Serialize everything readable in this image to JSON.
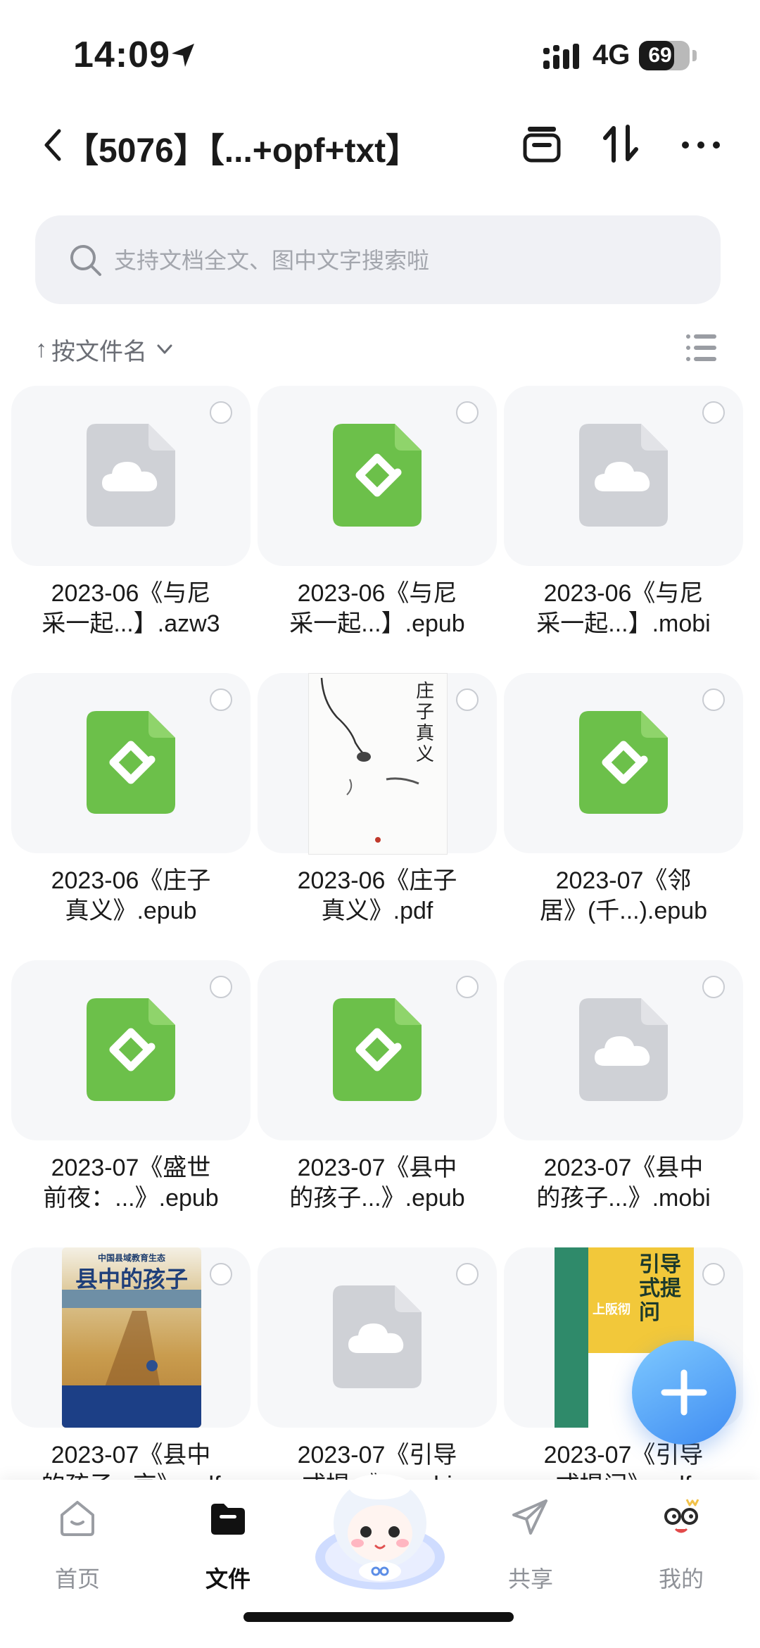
{
  "status_bar": {
    "time": "14:09",
    "network": "4G",
    "battery": "69",
    "battery_level": 0.69
  },
  "header": {
    "title": "【5076】【...+opf+txt】",
    "icons": [
      "back-icon",
      "archive-icon",
      "sort-toggle-icon",
      "more-icon"
    ]
  },
  "search": {
    "placeholder": "支持文档全文、图中文字搜索啦"
  },
  "sort": {
    "label": "按文件名",
    "arrow": "↑"
  },
  "files": [
    {
      "line1": "2023-06《与尼",
      "line2": "采一起...】.azw3",
      "icon": "cloud-file-icon"
    },
    {
      "line1": "2023-06《与尼",
      "line2": "采一起...】.epub",
      "icon": "epub-icon"
    },
    {
      "line1": "2023-06《与尼",
      "line2": "采一起...】.mobi",
      "icon": "cloud-file-icon"
    },
    {
      "line1": "2023-06《庄子",
      "line2": "真义》.epub",
      "icon": "epub-icon"
    },
    {
      "line1": "2023-06《庄子",
      "line2": "真义》.pdf",
      "icon": "book-cover-thumbnail",
      "cover_title": "庄子真义"
    },
    {
      "line1": "2023-07《邻",
      "line2": "居》(千...).epub",
      "icon": "epub-icon"
    },
    {
      "line1": "2023-07《盛世",
      "line2": "前夜：...》.epub",
      "icon": "epub-icon"
    },
    {
      "line1": "2023-07《县中",
      "line2": "的孩子...》.epub",
      "icon": "epub-icon"
    },
    {
      "line1": "2023-07《县中",
      "line2": "的孩子...》.mobi",
      "icon": "cloud-file-icon"
    },
    {
      "line1": "2023-07《县中",
      "line2": "的孩子...京》.pdf",
      "icon": "book-cover-thumbnail",
      "cover_title": "县中的孩子",
      "cover_subtitle": "中国县域教育生态"
    },
    {
      "line1": "2023-07《引导",
      "line2": "式提...》.mobi",
      "icon": "cloud-file-icon"
    },
    {
      "line1": "2023-07《引导",
      "line2": "式提问》.pdf",
      "icon": "book-cover-thumbnail",
      "cover_title": "引导式提问",
      "cover_subtitle": "上阪彻"
    }
  ],
  "tabs": [
    {
      "label": "首页",
      "icon": "home-icon"
    },
    {
      "label": "文件",
      "icon": "folder-icon",
      "active": true
    },
    {
      "label": "",
      "icon": "assistant-mascot-icon"
    },
    {
      "label": "共享",
      "icon": "share-icon"
    },
    {
      "label": "我的",
      "icon": "profile-icon"
    }
  ],
  "colors": {
    "epub_green": "#6cc04a",
    "cloud_gray": "#cfd1d6",
    "card_bg": "#f6f7f9",
    "fab_blue": "#4a95f4"
  }
}
